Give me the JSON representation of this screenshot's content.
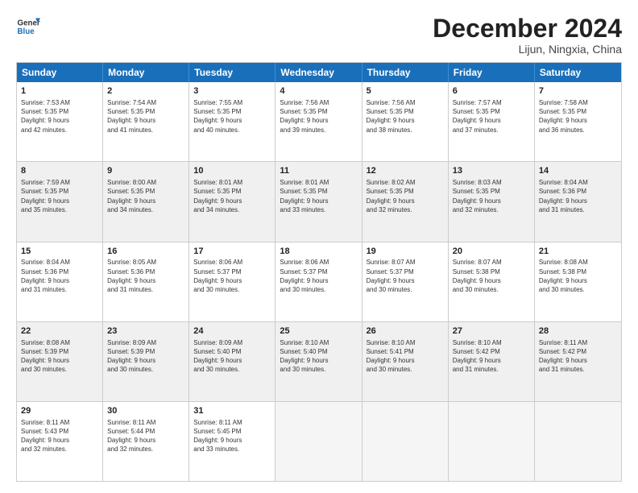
{
  "logo": {
    "line1": "General",
    "line2": "Blue"
  },
  "title": "December 2024",
  "location": "Lijun, Ningxia, China",
  "days_of_week": [
    "Sunday",
    "Monday",
    "Tuesday",
    "Wednesday",
    "Thursday",
    "Friday",
    "Saturday"
  ],
  "weeks": [
    [
      {
        "day": "1",
        "info": "Sunrise: 7:53 AM\nSunset: 5:35 PM\nDaylight: 9 hours\nand 42 minutes.",
        "shaded": false,
        "empty": false
      },
      {
        "day": "2",
        "info": "Sunrise: 7:54 AM\nSunset: 5:35 PM\nDaylight: 9 hours\nand 41 minutes.",
        "shaded": false,
        "empty": false
      },
      {
        "day": "3",
        "info": "Sunrise: 7:55 AM\nSunset: 5:35 PM\nDaylight: 9 hours\nand 40 minutes.",
        "shaded": false,
        "empty": false
      },
      {
        "day": "4",
        "info": "Sunrise: 7:56 AM\nSunset: 5:35 PM\nDaylight: 9 hours\nand 39 minutes.",
        "shaded": false,
        "empty": false
      },
      {
        "day": "5",
        "info": "Sunrise: 7:56 AM\nSunset: 5:35 PM\nDaylight: 9 hours\nand 38 minutes.",
        "shaded": false,
        "empty": false
      },
      {
        "day": "6",
        "info": "Sunrise: 7:57 AM\nSunset: 5:35 PM\nDaylight: 9 hours\nand 37 minutes.",
        "shaded": false,
        "empty": false
      },
      {
        "day": "7",
        "info": "Sunrise: 7:58 AM\nSunset: 5:35 PM\nDaylight: 9 hours\nand 36 minutes.",
        "shaded": false,
        "empty": false
      }
    ],
    [
      {
        "day": "8",
        "info": "Sunrise: 7:59 AM\nSunset: 5:35 PM\nDaylight: 9 hours\nand 35 minutes.",
        "shaded": true,
        "empty": false
      },
      {
        "day": "9",
        "info": "Sunrise: 8:00 AM\nSunset: 5:35 PM\nDaylight: 9 hours\nand 34 minutes.",
        "shaded": true,
        "empty": false
      },
      {
        "day": "10",
        "info": "Sunrise: 8:01 AM\nSunset: 5:35 PM\nDaylight: 9 hours\nand 34 minutes.",
        "shaded": true,
        "empty": false
      },
      {
        "day": "11",
        "info": "Sunrise: 8:01 AM\nSunset: 5:35 PM\nDaylight: 9 hours\nand 33 minutes.",
        "shaded": true,
        "empty": false
      },
      {
        "day": "12",
        "info": "Sunrise: 8:02 AM\nSunset: 5:35 PM\nDaylight: 9 hours\nand 32 minutes.",
        "shaded": true,
        "empty": false
      },
      {
        "day": "13",
        "info": "Sunrise: 8:03 AM\nSunset: 5:35 PM\nDaylight: 9 hours\nand 32 minutes.",
        "shaded": true,
        "empty": false
      },
      {
        "day": "14",
        "info": "Sunrise: 8:04 AM\nSunset: 5:36 PM\nDaylight: 9 hours\nand 31 minutes.",
        "shaded": true,
        "empty": false
      }
    ],
    [
      {
        "day": "15",
        "info": "Sunrise: 8:04 AM\nSunset: 5:36 PM\nDaylight: 9 hours\nand 31 minutes.",
        "shaded": false,
        "empty": false
      },
      {
        "day": "16",
        "info": "Sunrise: 8:05 AM\nSunset: 5:36 PM\nDaylight: 9 hours\nand 31 minutes.",
        "shaded": false,
        "empty": false
      },
      {
        "day": "17",
        "info": "Sunrise: 8:06 AM\nSunset: 5:37 PM\nDaylight: 9 hours\nand 30 minutes.",
        "shaded": false,
        "empty": false
      },
      {
        "day": "18",
        "info": "Sunrise: 8:06 AM\nSunset: 5:37 PM\nDaylight: 9 hours\nand 30 minutes.",
        "shaded": false,
        "empty": false
      },
      {
        "day": "19",
        "info": "Sunrise: 8:07 AM\nSunset: 5:37 PM\nDaylight: 9 hours\nand 30 minutes.",
        "shaded": false,
        "empty": false
      },
      {
        "day": "20",
        "info": "Sunrise: 8:07 AM\nSunset: 5:38 PM\nDaylight: 9 hours\nand 30 minutes.",
        "shaded": false,
        "empty": false
      },
      {
        "day": "21",
        "info": "Sunrise: 8:08 AM\nSunset: 5:38 PM\nDaylight: 9 hours\nand 30 minutes.",
        "shaded": false,
        "empty": false
      }
    ],
    [
      {
        "day": "22",
        "info": "Sunrise: 8:08 AM\nSunset: 5:39 PM\nDaylight: 9 hours\nand 30 minutes.",
        "shaded": true,
        "empty": false
      },
      {
        "day": "23",
        "info": "Sunrise: 8:09 AM\nSunset: 5:39 PM\nDaylight: 9 hours\nand 30 minutes.",
        "shaded": true,
        "empty": false
      },
      {
        "day": "24",
        "info": "Sunrise: 8:09 AM\nSunset: 5:40 PM\nDaylight: 9 hours\nand 30 minutes.",
        "shaded": true,
        "empty": false
      },
      {
        "day": "25",
        "info": "Sunrise: 8:10 AM\nSunset: 5:40 PM\nDaylight: 9 hours\nand 30 minutes.",
        "shaded": true,
        "empty": false
      },
      {
        "day": "26",
        "info": "Sunrise: 8:10 AM\nSunset: 5:41 PM\nDaylight: 9 hours\nand 30 minutes.",
        "shaded": true,
        "empty": false
      },
      {
        "day": "27",
        "info": "Sunrise: 8:10 AM\nSunset: 5:42 PM\nDaylight: 9 hours\nand 31 minutes.",
        "shaded": true,
        "empty": false
      },
      {
        "day": "28",
        "info": "Sunrise: 8:11 AM\nSunset: 5:42 PM\nDaylight: 9 hours\nand 31 minutes.",
        "shaded": true,
        "empty": false
      }
    ],
    [
      {
        "day": "29",
        "info": "Sunrise: 8:11 AM\nSunset: 5:43 PM\nDaylight: 9 hours\nand 32 minutes.",
        "shaded": false,
        "empty": false
      },
      {
        "day": "30",
        "info": "Sunrise: 8:11 AM\nSunset: 5:44 PM\nDaylight: 9 hours\nand 32 minutes.",
        "shaded": false,
        "empty": false
      },
      {
        "day": "31",
        "info": "Sunrise: 8:11 AM\nSunset: 5:45 PM\nDaylight: 9 hours\nand 33 minutes.",
        "shaded": false,
        "empty": false
      },
      {
        "day": "",
        "info": "",
        "shaded": false,
        "empty": true
      },
      {
        "day": "",
        "info": "",
        "shaded": false,
        "empty": true
      },
      {
        "day": "",
        "info": "",
        "shaded": false,
        "empty": true
      },
      {
        "day": "",
        "info": "",
        "shaded": false,
        "empty": true
      }
    ]
  ]
}
